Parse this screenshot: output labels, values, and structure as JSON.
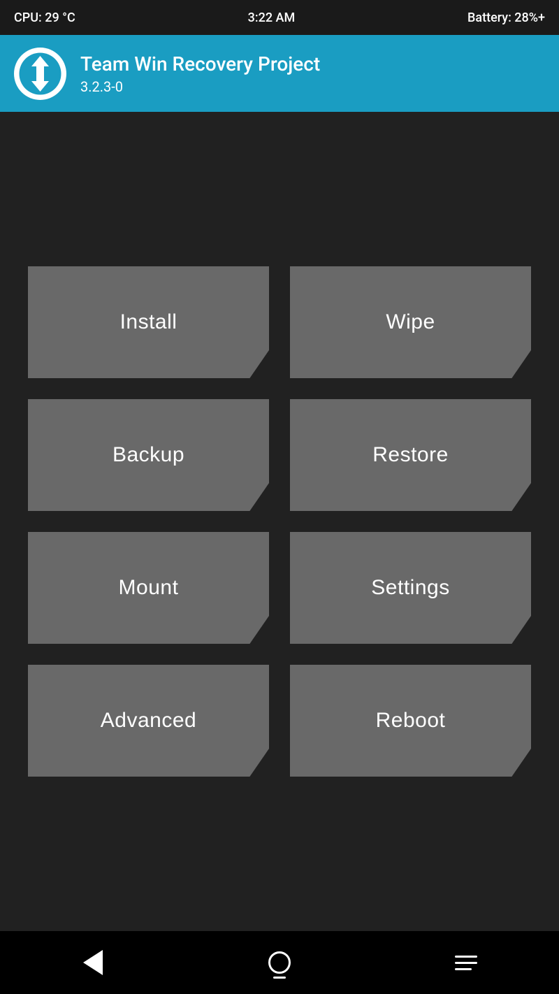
{
  "statusBar": {
    "cpu": "CPU: 29 °C",
    "time": "3:22 AM",
    "battery": "Battery: 28%+"
  },
  "header": {
    "title": "Team Win Recovery Project",
    "version": "3.2.3-0"
  },
  "buttons": {
    "row1": [
      {
        "label": "Install",
        "id": "install"
      },
      {
        "label": "Wipe",
        "id": "wipe"
      }
    ],
    "row2": [
      {
        "label": "Backup",
        "id": "backup"
      },
      {
        "label": "Restore",
        "id": "restore"
      }
    ],
    "row3": [
      {
        "label": "Mount",
        "id": "mount"
      },
      {
        "label": "Settings",
        "id": "settings"
      }
    ],
    "row4": [
      {
        "label": "Advanced",
        "id": "advanced"
      },
      {
        "label": "Reboot",
        "id": "reboot"
      }
    ]
  },
  "nav": {
    "back": "back",
    "home": "home",
    "menu": "menu"
  }
}
